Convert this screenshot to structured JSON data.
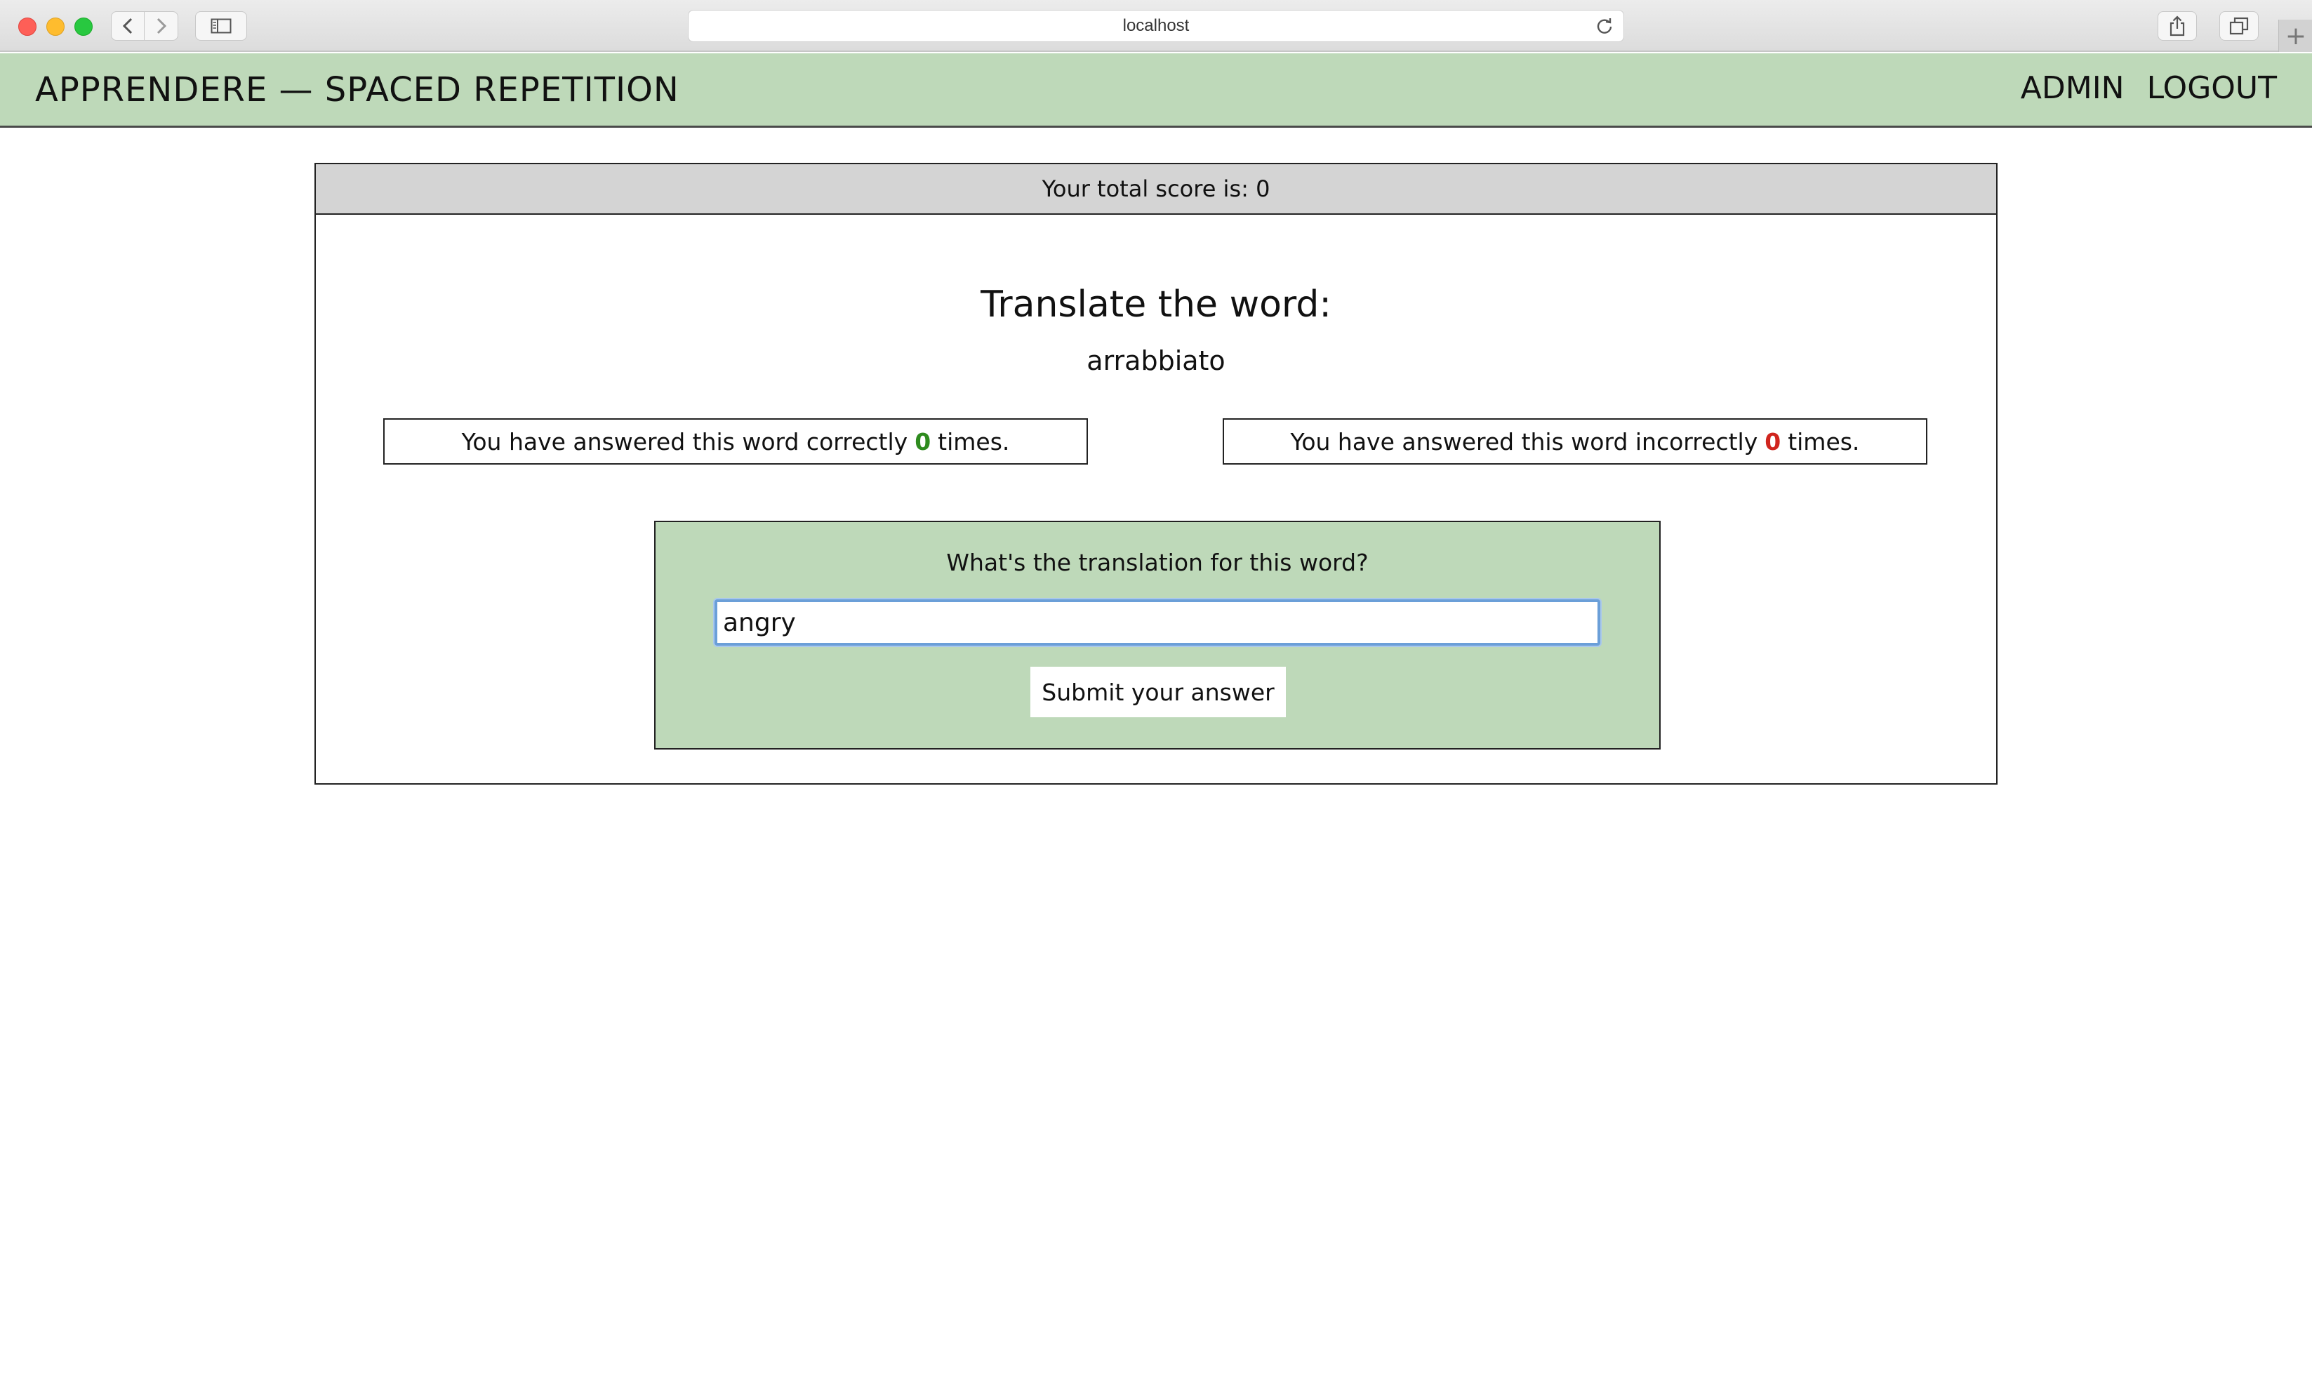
{
  "browser": {
    "url": "localhost",
    "newtab_symbol": "+"
  },
  "navbar": {
    "brand": "APPRENDERE — SPACED REPETITION",
    "links": [
      {
        "label": "ADMIN"
      },
      {
        "label": "LOGOUT"
      }
    ]
  },
  "score": {
    "text": "Your total score is: 0"
  },
  "quiz": {
    "heading": "Translate the word:",
    "word": "arrabbiato",
    "correct": {
      "prefix": "You have answered this word correctly",
      "count": "0",
      "suffix": "times."
    },
    "incorrect": {
      "prefix": "You have answered this word incorrectly",
      "count": "0",
      "suffix": "times."
    }
  },
  "answer_form": {
    "label": "What's the translation for this word?",
    "value": "angry",
    "submit_label": "Submit your answer"
  },
  "colors": {
    "navbar_bg": "#bed9b9",
    "correct_count": "#2e8b1e",
    "incorrect_count": "#d0251e",
    "input_focus": "#6b9fd8"
  }
}
